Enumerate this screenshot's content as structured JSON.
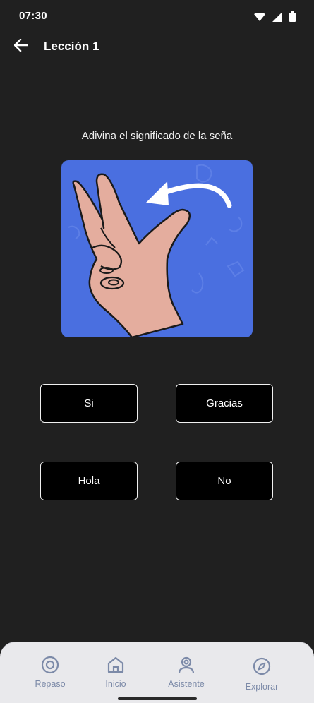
{
  "status_bar": {
    "time": "07:30"
  },
  "app_bar": {
    "title": "Lección 1"
  },
  "prompt": "Adivina el significado de la seña",
  "answers": [
    {
      "label": "Si"
    },
    {
      "label": "Gracias"
    },
    {
      "label": "Hola"
    },
    {
      "label": "No"
    }
  ],
  "bottom_nav": [
    {
      "label": "Repaso",
      "icon": "target-icon"
    },
    {
      "label": "Inicio",
      "icon": "home-icon"
    },
    {
      "label": "Asistente",
      "icon": "user-icon"
    },
    {
      "label": "Explorar",
      "icon": "compass-icon"
    }
  ],
  "colors": {
    "background": "#202020",
    "card": "#4a6fe0",
    "nav_background": "#e9e9ec",
    "nav_item": "#7c8aa8"
  }
}
